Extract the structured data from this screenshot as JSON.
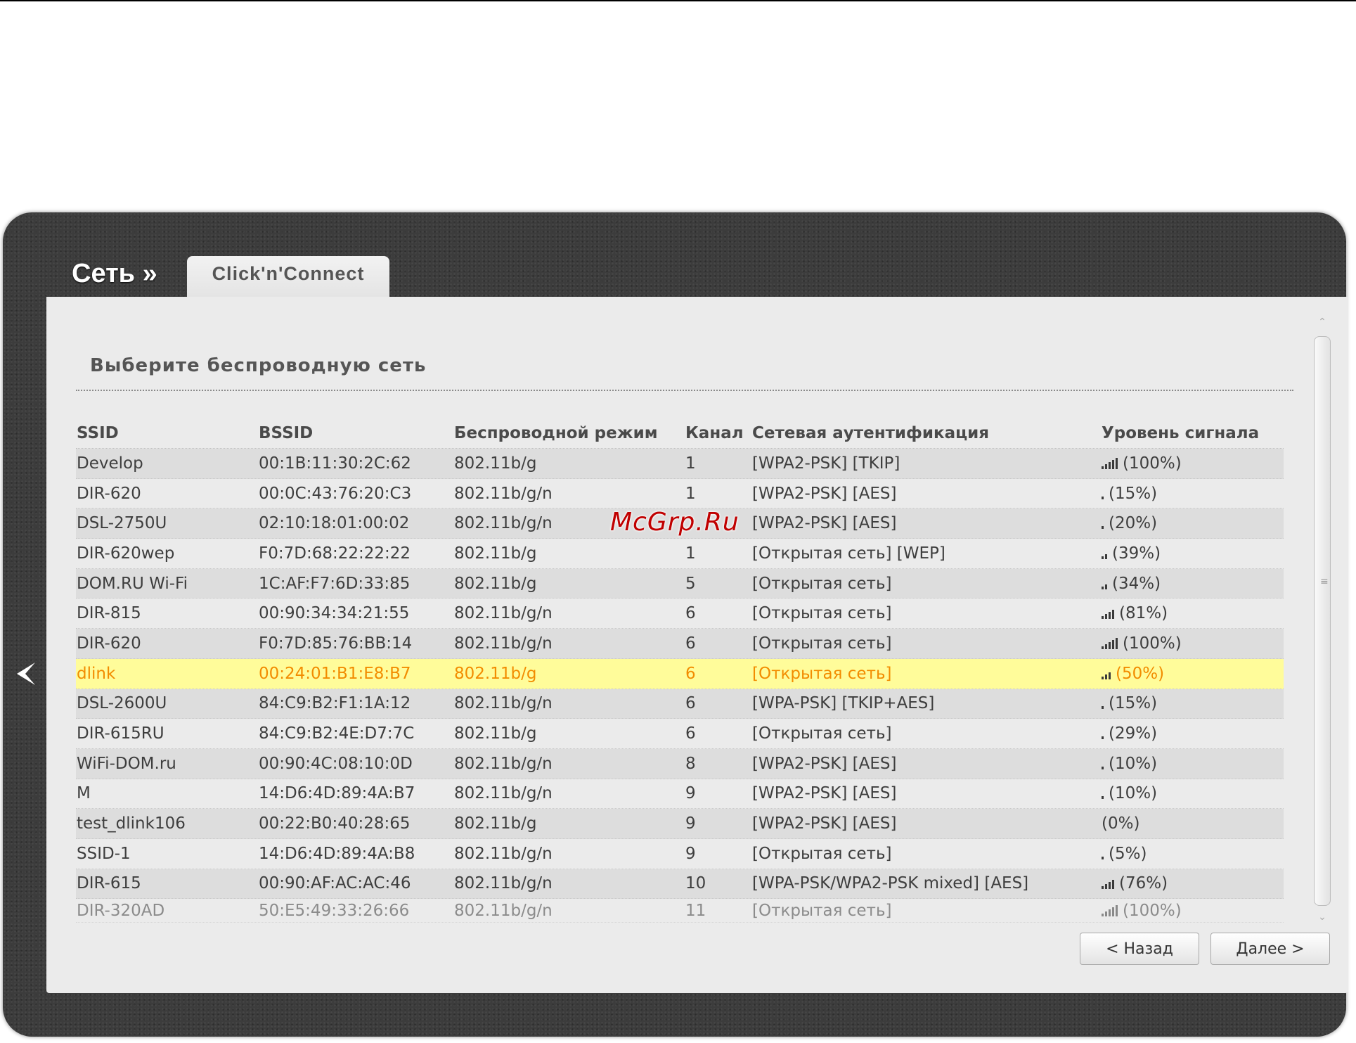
{
  "header": {
    "title": "Сеть »",
    "tab_label": "Click'n'Connect"
  },
  "section_title": "Выберите беспроводную сеть",
  "table": {
    "columns": [
      "SSID",
      "BSSID",
      "Беспроводной режим",
      "Канал",
      "Сетевая аутентификация",
      "Уровень сигнала"
    ],
    "rows": [
      {
        "ssid": "Develop",
        "bssid": "00:1B:11:30:2C:62",
        "mode": "802.11b/g",
        "channel": "1",
        "auth": "[WPA2-PSK] [TKIP]",
        "signal": "(100%)",
        "signal_level": 1.0
      },
      {
        "ssid": "DIR-620",
        "bssid": "00:0C:43:76:20:C3",
        "mode": "802.11b/g/n",
        "channel": "1",
        "auth": "[WPA2-PSK] [AES]",
        "signal": "(15%)",
        "signal_level": 0.15
      },
      {
        "ssid": "DSL-2750U",
        "bssid": "02:10:18:01:00:02",
        "mode": "802.11b/g/n",
        "channel": "",
        "auth": "[WPA2-PSK] [AES]",
        "signal": "(20%)",
        "signal_level": 0.2
      },
      {
        "ssid": "DIR-620wep",
        "bssid": "F0:7D:68:22:22:22",
        "mode": "802.11b/g",
        "channel": "1",
        "auth": "[Открытая сеть] [WEP]",
        "signal": "(39%)",
        "signal_level": 0.39
      },
      {
        "ssid": "DOM.RU Wi-Fi",
        "bssid": "1C:AF:F7:6D:33:85",
        "mode": "802.11b/g",
        "channel": "5",
        "auth": "[Открытая сеть]",
        "signal": "(34%)",
        "signal_level": 0.34
      },
      {
        "ssid": "DIR-815",
        "bssid": "00:90:34:34:21:55",
        "mode": "802.11b/g/n",
        "channel": "6",
        "auth": "[Открытая сеть]",
        "signal": "(81%)",
        "signal_level": 0.81
      },
      {
        "ssid": "DIR-620",
        "bssid": "F0:7D:85:76:BB:14",
        "mode": "802.11b/g/n",
        "channel": "6",
        "auth": "[Открытая сеть]",
        "signal": "(100%)",
        "signal_level": 1.0
      },
      {
        "ssid": "dlink",
        "bssid": "00:24:01:B1:E8:B7",
        "mode": "802.11b/g",
        "channel": "6",
        "auth": "[Открытая сеть]",
        "signal": "(50%)",
        "signal_level": 0.5,
        "selected": true
      },
      {
        "ssid": "DSL-2600U",
        "bssid": "84:C9:B2:F1:1A:12",
        "mode": "802.11b/g/n",
        "channel": "6",
        "auth": "[WPA-PSK] [TKIP+AES]",
        "signal": "(15%)",
        "signal_level": 0.15
      },
      {
        "ssid": "DIR-615RU",
        "bssid": "84:C9:B2:4E:D7:7C",
        "mode": "802.11b/g",
        "channel": "6",
        "auth": "[Открытая сеть]",
        "signal": "(29%)",
        "signal_level": 0.29
      },
      {
        "ssid": "WiFi-DOM.ru",
        "bssid": "00:90:4C:08:10:0D",
        "mode": "802.11b/g/n",
        "channel": "8",
        "auth": "[WPA2-PSK] [AES]",
        "signal": "(10%)",
        "signal_level": 0.1
      },
      {
        "ssid": "M",
        "bssid": "14:D6:4D:89:4A:B7",
        "mode": "802.11b/g/n",
        "channel": "9",
        "auth": "[WPA2-PSK] [AES]",
        "signal": "(10%)",
        "signal_level": 0.1
      },
      {
        "ssid": "test_dlink106",
        "bssid": "00:22:B0:40:28:65",
        "mode": "802.11b/g",
        "channel": "9",
        "auth": "[WPA2-PSK] [AES]",
        "signal": "(0%)",
        "signal_level": 0.0
      },
      {
        "ssid": "SSID-1",
        "bssid": "14:D6:4D:89:4A:B8",
        "mode": "802.11b/g/n",
        "channel": "9",
        "auth": "[Открытая сеть]",
        "signal": "(5%)",
        "signal_level": 0.05
      },
      {
        "ssid": "DIR-615",
        "bssid": "00:90:AF:AC:AC:46",
        "mode": "802.11b/g/n",
        "channel": "10",
        "auth": "[WPA-PSK/WPA2-PSK mixed] [AES]",
        "signal": "(76%)",
        "signal_level": 0.76
      },
      {
        "ssid": "DIR-320AD",
        "bssid": "50:E5:49:33:26:66",
        "mode": "802.11b/g/n",
        "channel": "11",
        "auth": "[Открытая сеть]",
        "signal": "(100%)",
        "signal_level": 1.0
      }
    ]
  },
  "buttons": {
    "back": "< Назад",
    "next": "Далее >"
  },
  "watermark": "McGrp.Ru",
  "icons": {
    "back_arrow": "chevron-left-icon",
    "signal": "signal-bars-icon"
  },
  "colors": {
    "selected_row_bg": "#fffc9a",
    "selected_row_text": "#f28c00",
    "frame": "#3c3c3c"
  }
}
